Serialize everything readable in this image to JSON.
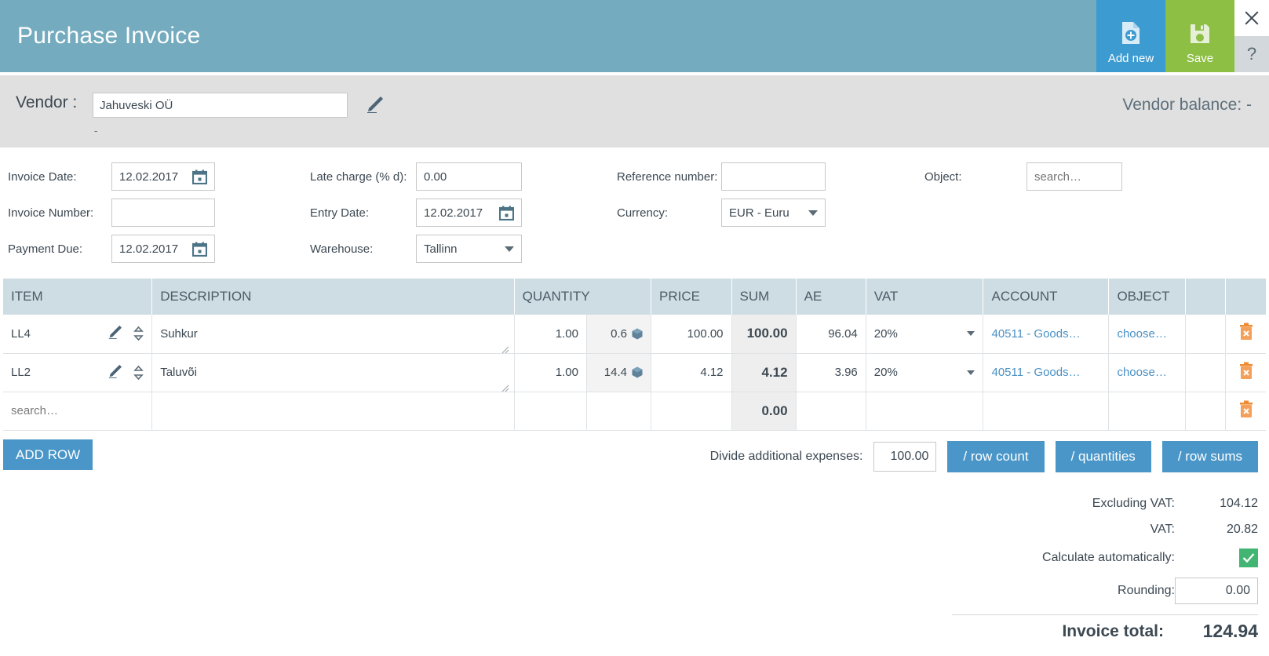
{
  "titlebar": {
    "title": "Purchase Invoice",
    "add_new_label": "Add new",
    "save_label": "Save",
    "help_label": "?",
    "accent_blue": "#3c9bd0",
    "accent_green": "#8cbf43",
    "header_bg": "#74abbf"
  },
  "vendor": {
    "label": "Vendor :",
    "value": "Jahuveski OÜ",
    "sub_value": "-",
    "balance_label": "Vendor balance: -"
  },
  "form": {
    "invoice_date_label": "Invoice Date:",
    "invoice_date_value": "12.02.2017",
    "invoice_number_label": "Invoice Number:",
    "invoice_number_value": "",
    "payment_due_label": "Payment Due:",
    "payment_due_value": "12.02.2017",
    "late_charge_label": "Late charge (% d):",
    "late_charge_value": "0.00",
    "entry_date_label": "Entry Date:",
    "entry_date_value": "12.02.2017",
    "warehouse_label": "Warehouse:",
    "warehouse_value": "Tallinn",
    "reference_number_label": "Reference number:",
    "reference_number_value": "",
    "currency_label": "Currency:",
    "currency_value": "EUR - Euru",
    "object_label": "Object:",
    "object_placeholder": "search…"
  },
  "table": {
    "columns": [
      "ITEM",
      "DESCRIPTION",
      "QUANTITY",
      "PRICE",
      "SUM",
      "AE",
      "VAT",
      "ACCOUNT",
      "OBJECT",
      "",
      ""
    ],
    "rows": [
      {
        "item": "LL4",
        "description": "Suhkur",
        "quantity": "1.00",
        "stock": "0.6",
        "price": "100.00",
        "sum": "100.00",
        "ae": "96.04",
        "vat": "20%",
        "account": "40511 - Goods…",
        "object": "choose…"
      },
      {
        "item": "LL2",
        "description": "Taluvõi",
        "quantity": "1.00",
        "stock": "14.4",
        "price": "4.12",
        "sum": "4.12",
        "ae": "3.96",
        "vat": "20%",
        "account": "40511 - Goods…",
        "object": "choose…"
      }
    ],
    "new_row": {
      "item_placeholder": "search…",
      "sum": "0.00"
    }
  },
  "actions": {
    "add_row_label": "ADD ROW",
    "divide_label": "Divide additional expenses:",
    "divide_value": "100.00",
    "divide_row_count_label": "/ row count",
    "divide_quantities_label": "/ quantities",
    "divide_row_sums_label": "/ row sums"
  },
  "totals": {
    "excluding_vat_label": "Excluding VAT:",
    "excluding_vat_value": "104.12",
    "vat_label": "VAT:",
    "vat_value": "20.82",
    "calculate_automatically_label": "Calculate automatically:",
    "calculate_automatically_checked": true,
    "rounding_label": "Rounding:",
    "rounding_value": "0.00",
    "invoice_total_label": "Invoice total:",
    "invoice_total_value": "124.94"
  }
}
